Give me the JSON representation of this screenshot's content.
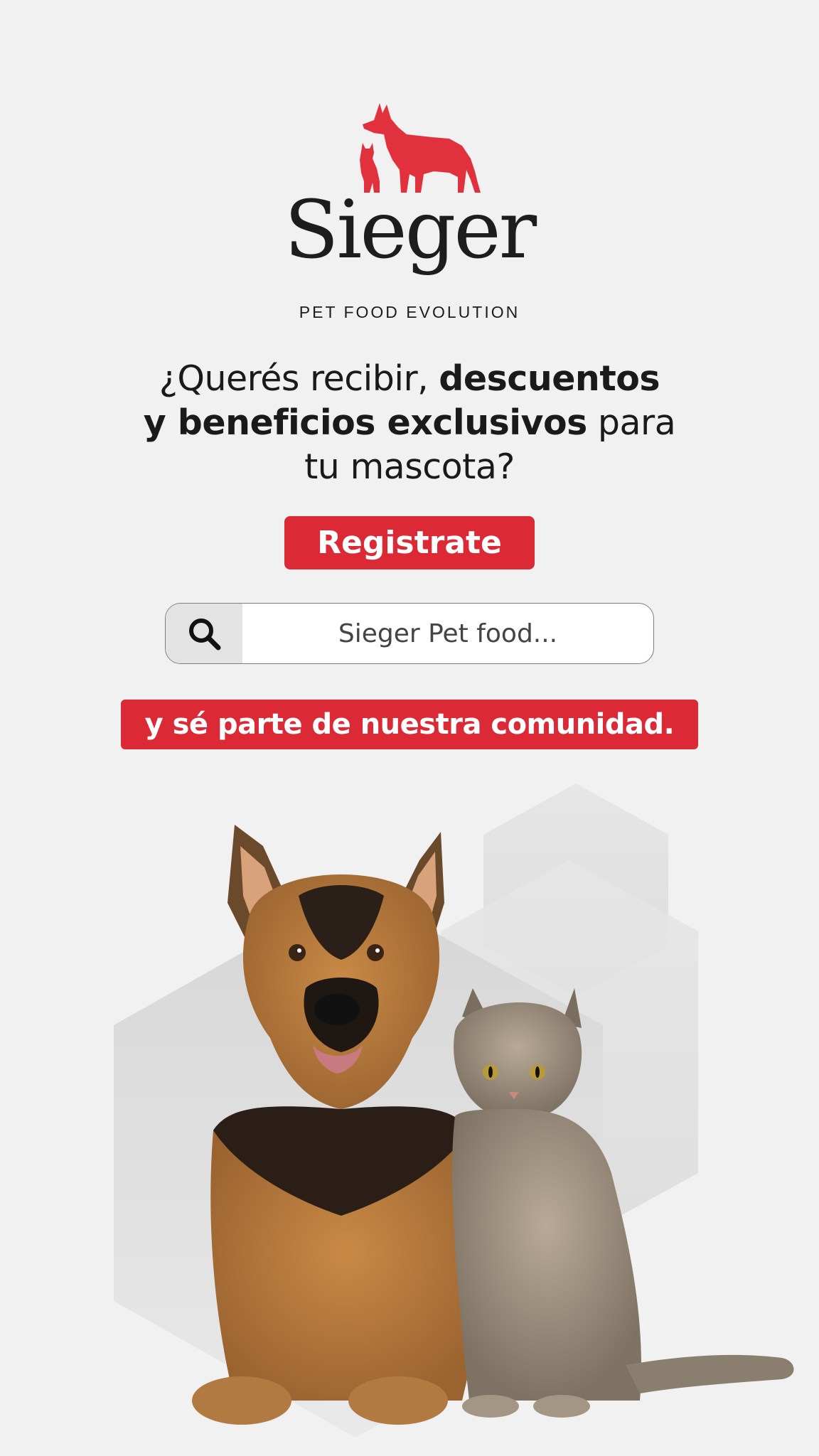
{
  "brand": {
    "name": "Sieger",
    "tagline": "PET FOOD EVOLUTION"
  },
  "headline": {
    "part1": "¿Querés recibir, ",
    "bold1": "descuentos",
    "bold2": "y beneficios exclusivos",
    "part2": " para",
    "part3": "tu mascota?"
  },
  "cta": {
    "register_label": "Registrate"
  },
  "search": {
    "placeholder": "Sieger Pet food...",
    "value": ""
  },
  "banner": {
    "text": "y sé parte de nuestra comunidad."
  },
  "hero": {
    "subjects": [
      "german-shepherd-dog",
      "tabby-cat"
    ]
  },
  "colors": {
    "accent": "#db2a36",
    "background": "#f2f1f1",
    "text": "#1c1c1c"
  }
}
